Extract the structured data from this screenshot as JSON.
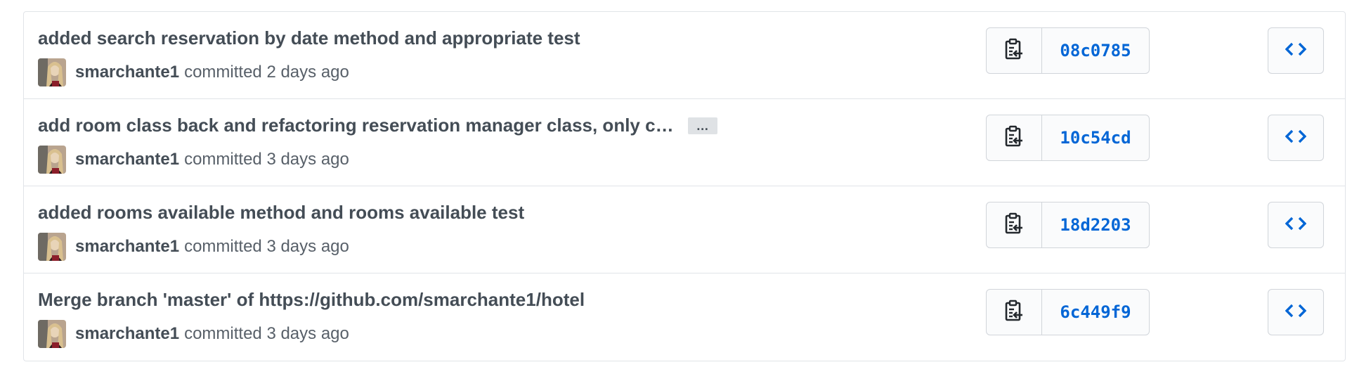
{
  "commits": [
    {
      "title": "added search reservation by date method and appropriate test",
      "expander": "",
      "author": "smarchante1",
      "meta": "committed 2 days ago",
      "sha": "08c0785"
    },
    {
      "title": "add room class back and refactoring reservation manager class, only c…",
      "expander": "…",
      "author": "smarchante1",
      "meta": "committed 3 days ago",
      "sha": "10c54cd"
    },
    {
      "title": "added rooms available method and rooms available test",
      "expander": "",
      "author": "smarchante1",
      "meta": "committed 3 days ago",
      "sha": "18d2203"
    },
    {
      "title": "Merge branch 'master' of https://github.com/smarchante1/hotel",
      "expander": "",
      "author": "smarchante1",
      "meta": "committed 3 days ago",
      "sha": "6c449f9"
    }
  ],
  "icons": {
    "copy": "clippy-icon",
    "browse": "code-icon"
  },
  "colors": {
    "link": "#0366d6",
    "title": "#444d56",
    "meta": "#586069",
    "border": "#e1e4e8"
  }
}
